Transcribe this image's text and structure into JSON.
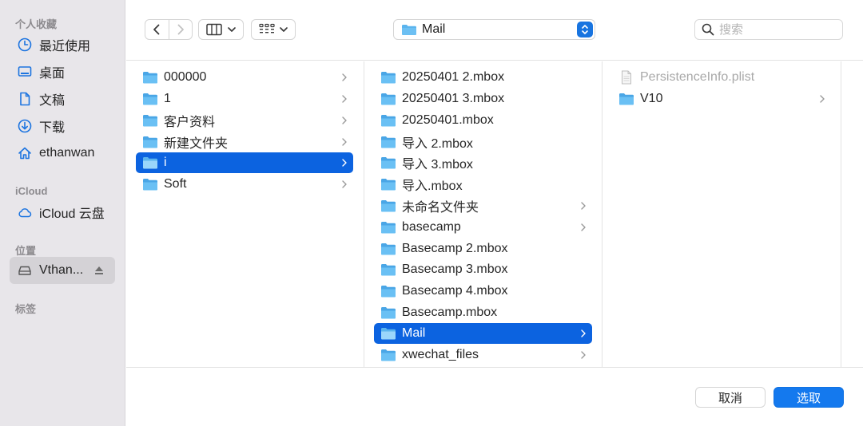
{
  "sidebar": {
    "sections": {
      "favorites": "个人收藏",
      "icloud": "iCloud",
      "locations": "位置",
      "tags": "标签"
    },
    "items": [
      {
        "label": "最近使用",
        "icon": "clock-icon"
      },
      {
        "label": "桌面",
        "icon": "desktop-icon"
      },
      {
        "label": "文稿",
        "icon": "document-icon"
      },
      {
        "label": "下载",
        "icon": "download-icon"
      },
      {
        "label": "ethanwan",
        "icon": "home-icon"
      },
      {
        "label": "iCloud 云盘",
        "icon": "cloud-icon"
      },
      {
        "label": "Vthan...",
        "icon": "drive-icon"
      }
    ]
  },
  "toolbar": {
    "location": "Mail",
    "search_placeholder": "搜索"
  },
  "columns": [
    {
      "items": [
        {
          "label": "000000",
          "has_children": true
        },
        {
          "label": "1",
          "has_children": true
        },
        {
          "label": "客户资料",
          "has_children": true
        },
        {
          "label": "新建文件夹",
          "has_children": true
        },
        {
          "label": "i",
          "has_children": true,
          "selected": true
        },
        {
          "label": "Soft",
          "has_children": true
        }
      ]
    },
    {
      "items": [
        {
          "label": "20250401 2.mbox",
          "has_children": false
        },
        {
          "label": "20250401 3.mbox",
          "has_children": false
        },
        {
          "label": "20250401.mbox",
          "has_children": false
        },
        {
          "label": "导入 2.mbox",
          "has_children": false
        },
        {
          "label": "导入 3.mbox",
          "has_children": false
        },
        {
          "label": "导入.mbox",
          "has_children": false
        },
        {
          "label": "未命名文件夹",
          "has_children": true
        },
        {
          "label": "basecamp",
          "has_children": true
        },
        {
          "label": "Basecamp 2.mbox",
          "has_children": false
        },
        {
          "label": "Basecamp 3.mbox",
          "has_children": false
        },
        {
          "label": "Basecamp 4.mbox",
          "has_children": false
        },
        {
          "label": "Basecamp.mbox",
          "has_children": false
        },
        {
          "label": "Mail",
          "has_children": true,
          "selected": true
        },
        {
          "label": "xwechat_files",
          "has_children": true
        }
      ]
    },
    {
      "items": [
        {
          "label": "PersistenceInfo.plist",
          "type": "file",
          "has_children": false
        },
        {
          "label": "V10",
          "has_children": true
        }
      ]
    }
  ],
  "buttons": {
    "cancel": "取消",
    "choose": "选取"
  },
  "colors": {
    "accent": "#0c63e0",
    "folder": "#5ab4ee",
    "sidebar_bg": "#e8e6ea"
  }
}
